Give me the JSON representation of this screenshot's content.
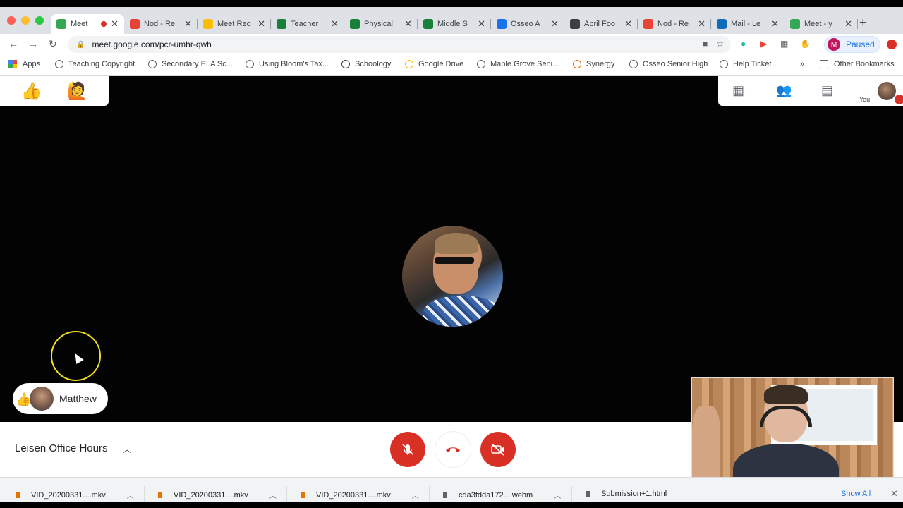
{
  "browser": {
    "tabs": [
      {
        "title": "Meet",
        "color": "#34a853",
        "active": true,
        "recording": true
      },
      {
        "title": "Nod - Re",
        "color": "#ea4335"
      },
      {
        "title": "Meet Rec",
        "color": "#fbbc04"
      },
      {
        "title": "Teacher",
        "color": "#188038"
      },
      {
        "title": "Physical",
        "color": "#188038"
      },
      {
        "title": "Middle S",
        "color": "#188038"
      },
      {
        "title": "Osseo A",
        "color": "#1a73e8"
      },
      {
        "title": "April Foo",
        "color": "#3c4043"
      },
      {
        "title": "Nod - Re",
        "color": "#ea4335"
      },
      {
        "title": "Mail - Le",
        "color": "#0f6cbd"
      },
      {
        "title": "Meet - y",
        "color": "#34a853"
      }
    ],
    "url": "meet.google.com/pcr-umhr-qwh",
    "profile_initial": "M",
    "profile_status": "Paused",
    "bookmarks": [
      "Apps",
      "Teaching Copyright",
      "Secondary ELA Sc...",
      "Using Bloom's Tax...",
      "Schoology",
      "Google Drive",
      "Maple Grove Seni...",
      "Synergy",
      "Osseo Senior High",
      "Help Ticket",
      "»",
      "Other Bookmarks"
    ]
  },
  "meet": {
    "reactions": [
      "👍",
      "🙋"
    ],
    "self_label": "You",
    "participant_name": "Matthew",
    "participant_reaction": "👍",
    "meeting_title": "Leisen Office Hours",
    "controls": {
      "mic_icon": "mic-off-icon",
      "hangup_icon": "phone-hangup-icon",
      "camera_icon": "camera-off-icon"
    }
  },
  "downloads": {
    "items": [
      "VID_20200331....mkv",
      "VID_20200331....mkv",
      "VID_20200331....mkv",
      "cda3fdda172....webm",
      "Submission+1.html"
    ],
    "show_all": "Show All"
  }
}
